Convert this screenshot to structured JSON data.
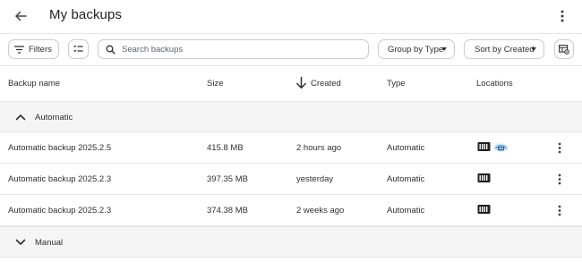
{
  "header": {
    "title": "My backups",
    "back_icon": "arrow-left-icon",
    "more_icon": "more-vert-icon"
  },
  "toolbar": {
    "filters_label": "Filters",
    "search_placeholder": "Search backups",
    "search_value": "",
    "group_by_label": "Group by Type",
    "sort_by_label": "Sort by Created"
  },
  "columns": {
    "name": "Backup name",
    "size": "Size",
    "created": "Created",
    "type": "Type",
    "locations": "Locations"
  },
  "groups": [
    {
      "label": "Automatic",
      "expanded": true,
      "rows": [
        {
          "name": "Automatic backup 2025.2.5",
          "size": "415.8 MB",
          "created": "2 hours ago",
          "type": "Automatic",
          "locations": [
            "nas-icon",
            "cloud-icon"
          ]
        },
        {
          "name": "Automatic backup 2025.2.3",
          "size": "397.35 MB",
          "created": "yesterday",
          "type": "Automatic",
          "locations": [
            "nas-icon"
          ]
        },
        {
          "name": "Automatic backup 2025.2.3",
          "size": "374.38 MB",
          "created": "2 weeks ago",
          "type": "Automatic",
          "locations": [
            "nas-icon"
          ]
        }
      ]
    },
    {
      "label": "Manual",
      "expanded": false,
      "rows": []
    }
  ],
  "colors": {
    "divider": "#e6e6e6",
    "group_bg": "#f5f5f5",
    "cloud_accent": "#4a90c8"
  }
}
